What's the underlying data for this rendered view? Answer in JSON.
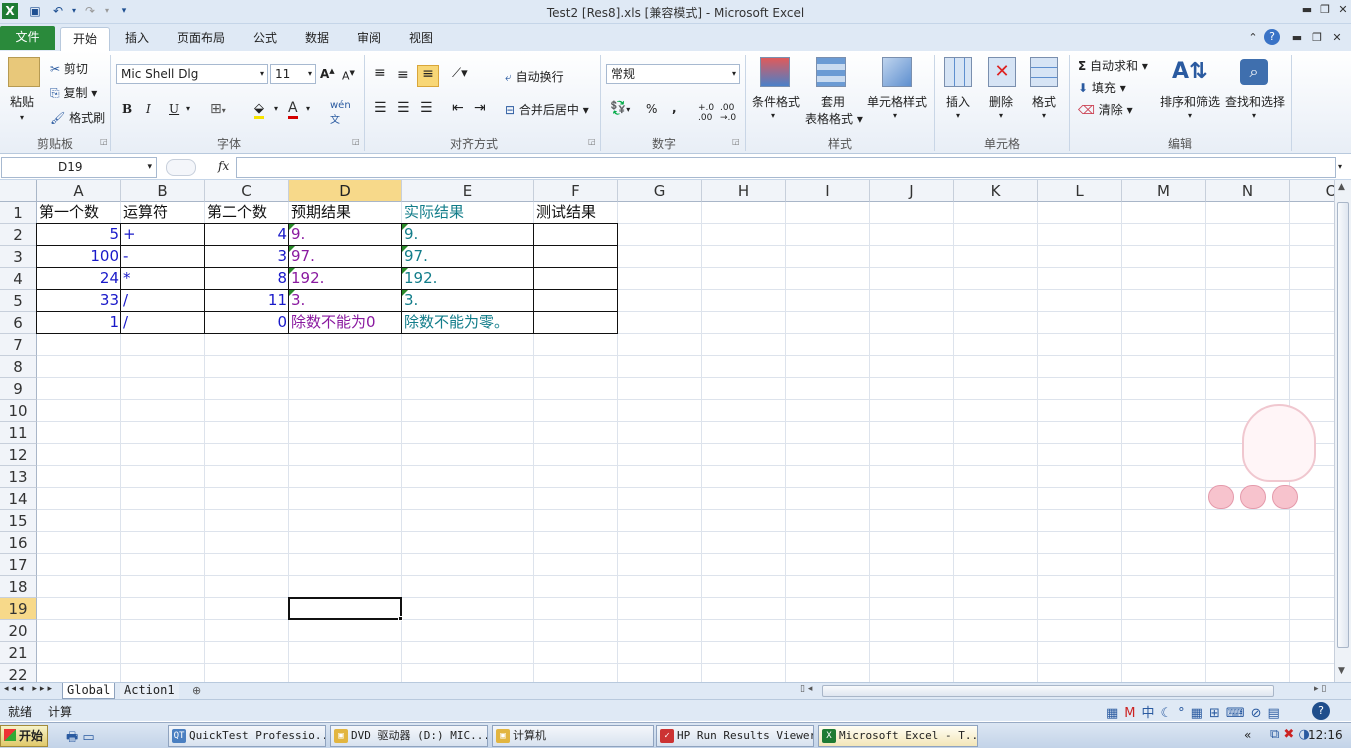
{
  "window": {
    "title": "Test2 [Res8].xls  [兼容模式]  -  Microsoft Excel",
    "controls": {
      "minimize": "▬",
      "restore": "❐",
      "close": "✕"
    }
  },
  "ribbon_tabs": [
    "文件",
    "开始",
    "插入",
    "页面布局",
    "公式",
    "数据",
    "审阅",
    "视图"
  ],
  "clipboard": {
    "paste": "粘贴",
    "cut": "剪切",
    "copy": "复制",
    "format_painter": "格式刷",
    "label": "剪贴板"
  },
  "font": {
    "name": "Mic Shell Dlg",
    "size": "11",
    "label": "字体",
    "bold": "B",
    "italic": "I",
    "underline": "U"
  },
  "alignment": {
    "wrap": "自动换行",
    "merge": "合并后居中",
    "label": "对齐方式"
  },
  "number": {
    "format": "常规",
    "percent": "%",
    "comma": ",",
    "label": "数字"
  },
  "styles": {
    "conditional": "条件格式",
    "table_line1": "套用",
    "table_line2": "表格格式",
    "cell_styles": "单元格样式",
    "label": "样式"
  },
  "cells": {
    "insert": "插入",
    "delete": "删除",
    "format": "格式",
    "label": "单元格"
  },
  "editing": {
    "autosum": "自动求和",
    "fill": "填充",
    "clear": "清除",
    "sort": "排序和筛选",
    "find": "查找和选择",
    "label": "编辑"
  },
  "formula_bar": {
    "name_box": "D19",
    "fx": "fx",
    "value": ""
  },
  "columns": [
    "A",
    "B",
    "C",
    "D",
    "E",
    "F",
    "G",
    "H",
    "I",
    "J",
    "K",
    "L",
    "M",
    "N",
    "O"
  ],
  "rows": [
    "1",
    "2",
    "3",
    "4",
    "5",
    "6",
    "7",
    "8",
    "9",
    "10",
    "11",
    "12",
    "13",
    "14",
    "15",
    "16",
    "17",
    "18",
    "19",
    "20",
    "21",
    "22"
  ],
  "selected_cell": {
    "col": "D",
    "row": "19"
  },
  "sheet": {
    "headers": [
      "第一个数",
      "运算符",
      "第二个数",
      "预期结果",
      "实际结果",
      "测试结果"
    ],
    "data": [
      [
        "5",
        "+",
        "4",
        "9.",
        "9.",
        ""
      ],
      [
        "100",
        "-",
        "3",
        "97.",
        "97.",
        ""
      ],
      [
        "24",
        "*",
        "8",
        "192.",
        "192.",
        ""
      ],
      [
        "33",
        "/",
        "11",
        "3.",
        "3.",
        ""
      ],
      [
        "1",
        "/",
        "0",
        "除数不能为0",
        "除数不能为零。",
        ""
      ]
    ]
  },
  "sheet_tabs": [
    "Global",
    "Action1"
  ],
  "status": {
    "ready": "就绪",
    "calc": "计算"
  },
  "taskbar": {
    "start": "开始",
    "tasks": [
      "QuickTest Professio...",
      "DVD 驱动器 (D:) MIC...",
      "计算机",
      "HP Run Results Viewer",
      "Microsoft Excel - T..."
    ],
    "clock": "12:16"
  },
  "colors": {
    "file_tab": "#2a8a3b",
    "selection_header": "#f7d98a",
    "number_blue": "#1919c9",
    "expected_purple": "#8a1aa0",
    "actual_teal": "#127d8a"
  }
}
